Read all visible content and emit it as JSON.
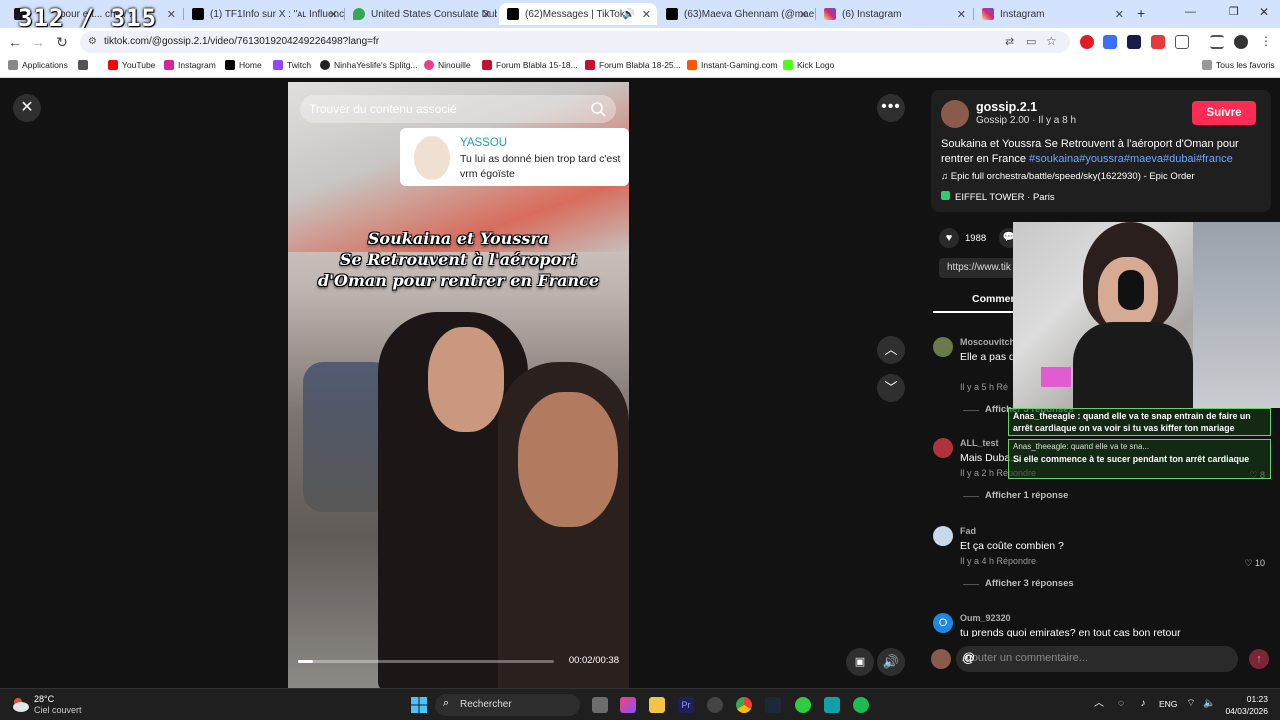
{
  "overlay_counter": "312 / 315",
  "tabs": [
    {
      "label": "pour ett... che / X",
      "color": "#1a1a1a"
    },
    {
      "label": "(1) TF1Info sur X : \"ᴀʟ Influence...",
      "color": "#000000"
    },
    {
      "label": "United States Consulate Dubai",
      "color": "#34a853"
    },
    {
      "label": "(62)Messages | TikTok",
      "color": "#000000"
    },
    {
      "label": "(63)Maeva Ghennam (@maeva...",
      "color": "#000000"
    },
    {
      "label": "(6) Instagram",
      "color": "#d6249f"
    },
    {
      "label": "Instagram",
      "color": "#d6249f"
    }
  ],
  "address": {
    "url": "tiktok.com/@gossip.2.1/video/7613019204249226498?lang=fr"
  },
  "bookmarks": [
    {
      "label": "Applications",
      "color": "#666666"
    },
    {
      "label": "YouTube",
      "color": "#ff0000"
    },
    {
      "label": "Instagram",
      "color": "#d6249f"
    },
    {
      "label": "Home",
      "color": "#000000"
    },
    {
      "label": "Twitch",
      "color": "#9146ff"
    },
    {
      "label": "NinhaYeslife's Splitg...",
      "color": "#222222"
    },
    {
      "label": "Ninouille",
      "color": "#e83e8c"
    },
    {
      "label": "Forum Blabla 15-18...",
      "color": "#c8102e"
    },
    {
      "label": "Forum Blabla 18-25...",
      "color": "#c8102e"
    },
    {
      "label": "Instant-Gaming.com",
      "color": "#ff5400"
    },
    {
      "label": "Kick Logo",
      "color": "#53fc18"
    },
    {
      "label": "Tous les favoris",
      "color": "#666666"
    }
  ],
  "video": {
    "search_placeholder": "Trouver du contenu associé",
    "bubble_name": "YASSOU",
    "bubble_text": "Tu lui as donné bien trop tard c'est vrm égoïste",
    "caption_lines": [
      "Soukaina et Youssra",
      "Se Retrouvent à l'aéroport",
      "d'Oman pour rentrer en France"
    ],
    "time": "00:02/00:38",
    "progress": 0.06
  },
  "post": {
    "author": "gossip.2.1",
    "meta": "Gossip 2.00 · Il y a 8 h",
    "follow_label": "Suivre",
    "desc_text": "Soukaina et Youssra Se Retrouvent à l'aéroport d'Oman pour rentrer en France ",
    "desc_tags": "#soukaina#youssra#maeva#dubai#france",
    "music": "Epic full orchestra/battle/speed/sky(1622930) - Epic Order",
    "location": "EIFFEL TOWER · Paris",
    "likes": "1988",
    "link": "https://www.tik",
    "comments_tab": "Commen"
  },
  "comments": [
    {
      "user": "Moscouvitch",
      "text": "Elle a pas d… tuinsie",
      "meta": "Il y a 5 h   Ré",
      "like": "",
      "replies": "Afficher 5 réponses",
      "avatar_color": "#6b7a4a"
    },
    {
      "user": "ALL_test",
      "text": "Mais Duba…",
      "meta": "Il y a 2 h   Répondre",
      "like": "8",
      "replies": "Afficher 1 réponse",
      "avatar_color": "#b0323a"
    },
    {
      "user": "Fad",
      "text": "Et ça coûte combien ?",
      "meta": "Il y a 4 h   Répondre",
      "like": "10",
      "replies": "Afficher 3 réponses",
      "avatar_color": "#c9d9ec"
    },
    {
      "user": "Oum_92320",
      "text": "tu prends quoi emirates? en tout cas bon retour",
      "meta": "",
      "like": "",
      "replies": "",
      "avatar_color": "#1e88e5",
      "initial": "O"
    }
  ],
  "comment_input": {
    "placeholder": "Ajouter un commentaire..."
  },
  "chat": [
    {
      "text": "Anas_theeagle : quand elle va te snap entrain de faire un arrêt cardiaque on va voir si tu vas kiffer ton mariage"
    },
    {
      "reply": "Anas_theeagle: quand elle va te sna...",
      "text": "Si elle commence à te sucer pendant ton arrêt cardiaque"
    }
  ],
  "taskbar": {
    "temp": "28°C",
    "weather": "Ciel couvert",
    "search": "Rechercher",
    "lang": "ENG",
    "time": "01:23",
    "date": "04/03/2026"
  }
}
